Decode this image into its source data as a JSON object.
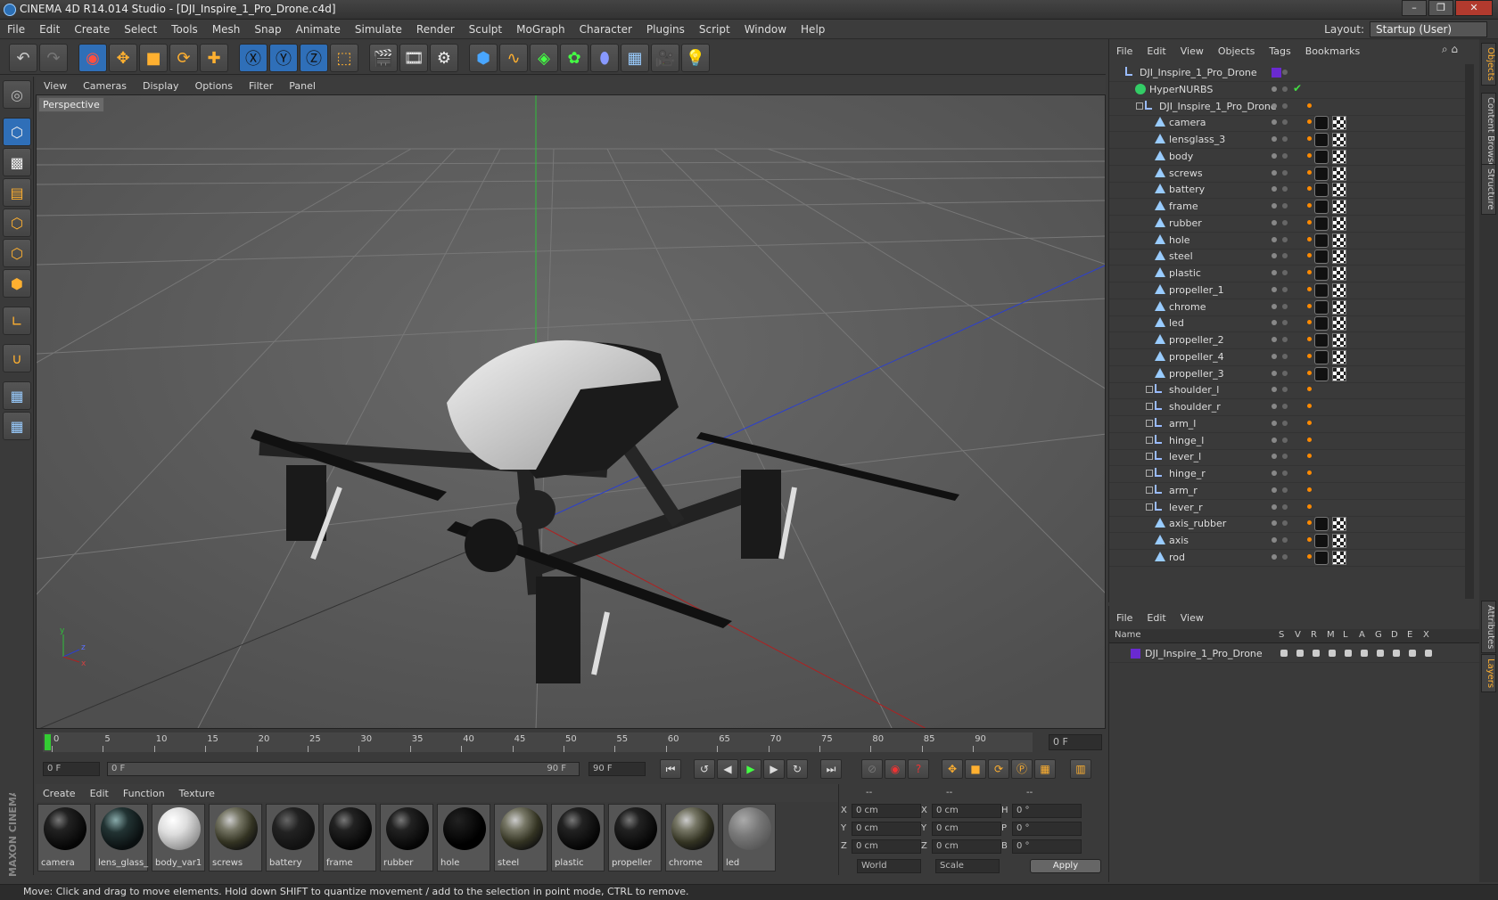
{
  "window": {
    "title": "CINEMA 4D R14.014 Studio - [DJI_Inspire_1_Pro_Drone.c4d]",
    "buttons": [
      "–",
      "❐",
      "✕"
    ]
  },
  "menu": [
    "File",
    "Edit",
    "Create",
    "Select",
    "Tools",
    "Mesh",
    "Snap",
    "Animate",
    "Simulate",
    "Render",
    "Sculpt",
    "MoGraph",
    "Character",
    "Plugins",
    "Script",
    "Window",
    "Help"
  ],
  "layout": {
    "label": "Layout:",
    "value": "Startup (User)"
  },
  "viewport": {
    "menu": [
      "View",
      "Cameras",
      "Display",
      "Options",
      "Filter",
      "Panel"
    ],
    "label": "Perspective"
  },
  "timeline": {
    "ticks": [
      "0",
      "5",
      "10",
      "15",
      "20",
      "25",
      "30",
      "35",
      "40",
      "45",
      "50",
      "55",
      "60",
      "65",
      "70",
      "75",
      "80",
      "85",
      "90"
    ],
    "current_frame": "0 F"
  },
  "transport": {
    "start": "0 F",
    "range_start": "0 F",
    "range_end": "90 F",
    "end": "90 F"
  },
  "materials": {
    "menu": [
      "Create",
      "Edit",
      "Function",
      "Texture"
    ],
    "items": [
      {
        "name": "camera",
        "style": "dark"
      },
      {
        "name": "lens_glass_",
        "style": "glass"
      },
      {
        "name": "body_var1",
        "style": "white"
      },
      {
        "name": "screws",
        "style": "env"
      },
      {
        "name": "battery",
        "style": "battery"
      },
      {
        "name": "frame",
        "style": "dark"
      },
      {
        "name": "rubber",
        "style": "dark"
      },
      {
        "name": "hole",
        "style": "black"
      },
      {
        "name": "steel",
        "style": "env"
      },
      {
        "name": "plastic",
        "style": "dark"
      },
      {
        "name": "propeller",
        "style": "dark"
      },
      {
        "name": "chrome",
        "style": "env"
      },
      {
        "name": "led",
        "style": "led"
      }
    ]
  },
  "coords": {
    "headers": [
      "--",
      "--",
      "--"
    ],
    "rows": [
      {
        "l1": "X",
        "v1": "0 cm",
        "l2": "X",
        "v2": "0 cm",
        "l3": "H",
        "v3": "0 °"
      },
      {
        "l1": "Y",
        "v1": "0 cm",
        "l2": "Y",
        "v2": "0 cm",
        "l3": "P",
        "v3": "0 °"
      },
      {
        "l1": "Z",
        "v1": "0 cm",
        "l2": "Z",
        "v2": "0 cm",
        "l3": "B",
        "v3": "0 °"
      }
    ],
    "mode1": "World",
    "mode2": "Scale",
    "apply": "Apply"
  },
  "objects": {
    "menu": [
      "File",
      "Edit",
      "View",
      "Objects",
      "Tags",
      "Bookmarks"
    ],
    "items": [
      {
        "name": "DJI_Inspire_1_Pro_Drone",
        "depth": 0,
        "type": "null",
        "tags": "layer"
      },
      {
        "name": "HyperNURBS",
        "depth": 1,
        "type": "nurbs",
        "tags": "check"
      },
      {
        "name": "DJI_Inspire_1_Pro_Drone",
        "depth": 2,
        "type": "null",
        "tags": "dot"
      },
      {
        "name": "camera",
        "depth": 3,
        "type": "poly",
        "tags": "mat"
      },
      {
        "name": "lensglass_3",
        "depth": 3,
        "type": "poly",
        "tags": "mat"
      },
      {
        "name": "body",
        "depth": 3,
        "type": "poly",
        "tags": "mat"
      },
      {
        "name": "screws",
        "depth": 3,
        "type": "poly",
        "tags": "mat"
      },
      {
        "name": "battery",
        "depth": 3,
        "type": "poly",
        "tags": "mat"
      },
      {
        "name": "frame",
        "depth": 3,
        "type": "poly",
        "tags": "mat"
      },
      {
        "name": "rubber",
        "depth": 3,
        "type": "poly",
        "tags": "mat"
      },
      {
        "name": "hole",
        "depth": 3,
        "type": "poly",
        "tags": "mat"
      },
      {
        "name": "steel",
        "depth": 3,
        "type": "poly",
        "tags": "mat"
      },
      {
        "name": "plastic",
        "depth": 3,
        "type": "poly",
        "tags": "mat"
      },
      {
        "name": "propeller_1",
        "depth": 3,
        "type": "poly",
        "tags": "mat"
      },
      {
        "name": "chrome",
        "depth": 3,
        "type": "poly",
        "tags": "mat"
      },
      {
        "name": "led",
        "depth": 3,
        "type": "poly",
        "tags": "mat"
      },
      {
        "name": "propeller_2",
        "depth": 3,
        "type": "poly",
        "tags": "mat"
      },
      {
        "name": "propeller_4",
        "depth": 3,
        "type": "poly",
        "tags": "mat"
      },
      {
        "name": "propeller_3",
        "depth": 3,
        "type": "poly",
        "tags": "mat"
      },
      {
        "name": "shoulder_l",
        "depth": 3,
        "type": "null",
        "tags": "dot"
      },
      {
        "name": "shoulder_r",
        "depth": 3,
        "type": "null",
        "tags": "dot"
      },
      {
        "name": "arm_l",
        "depth": 3,
        "type": "null",
        "tags": "dot"
      },
      {
        "name": "hinge_l",
        "depth": 3,
        "type": "null",
        "tags": "dot"
      },
      {
        "name": "lever_l",
        "depth": 3,
        "type": "null",
        "tags": "dot"
      },
      {
        "name": "hinge_r",
        "depth": 3,
        "type": "null",
        "tags": "dot"
      },
      {
        "name": "arm_r",
        "depth": 3,
        "type": "null",
        "tags": "dot"
      },
      {
        "name": "lever_r",
        "depth": 3,
        "type": "null",
        "tags": "dot"
      },
      {
        "name": "axis_rubber",
        "depth": 3,
        "type": "poly",
        "tags": "mat"
      },
      {
        "name": "axis",
        "depth": 3,
        "type": "poly",
        "tags": "mat"
      },
      {
        "name": "rod",
        "depth": 3,
        "type": "poly",
        "tags": "mat"
      }
    ]
  },
  "layers": {
    "menu": [
      "File",
      "Edit",
      "View"
    ],
    "columns": [
      "Name",
      "S",
      "V",
      "R",
      "M",
      "L",
      "A",
      "G",
      "D",
      "E",
      "X"
    ],
    "items": [
      {
        "name": "DJI_Inspire_1_Pro_Drone",
        "color": "#6a2ad0"
      }
    ]
  },
  "sidetabs": [
    "Objects",
    "Content Browser",
    "Structure",
    "Attributes",
    "Layers"
  ],
  "status": "Move: Click and drag to move elements. Hold down SHIFT to quantize movement / add to the selection in point mode, CTRL to remove.",
  "brand": "MAXON CINEMA 4D",
  "colors": {
    "accent": "#ff8a00",
    "selection": "#2f6fb8",
    "layer": "#6a2ad0"
  }
}
